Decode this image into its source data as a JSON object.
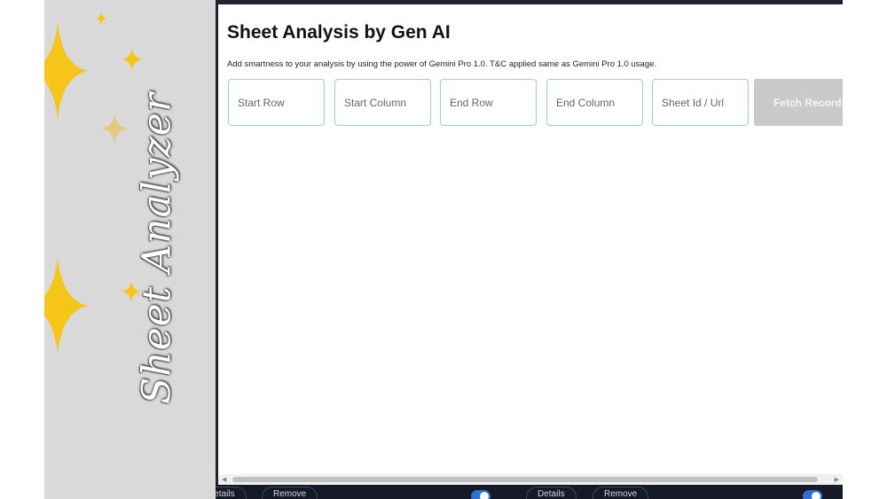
{
  "banner": {
    "title": "Sheet Analyzer",
    "accent_color": "#f5c518",
    "background_color": "#d9d9d9"
  },
  "dialog": {
    "title": "Sheet Analysis by Gen AI",
    "subtitle": "Add smartness to your analysis by using the power of Gemini Pro 1.0. T&C applied same as Gemini Pro 1.0 usage.",
    "fields": {
      "start_row": {
        "placeholder": "Start Row",
        "value": ""
      },
      "start_column": {
        "placeholder": "Start Column",
        "value": ""
      },
      "end_row": {
        "placeholder": "End Row",
        "value": ""
      },
      "end_column": {
        "placeholder": "End Column",
        "value": ""
      },
      "sheet_id": {
        "placeholder": "Sheet Id / Url",
        "value": ""
      }
    },
    "fetch_button": {
      "label": "Fetch Records",
      "state": "disabled"
    },
    "field_border_color": "#9ccbea"
  },
  "background_app": {
    "details_label": "Details",
    "remove_label": "Remove",
    "toggle_color": "#2f6fd6"
  }
}
